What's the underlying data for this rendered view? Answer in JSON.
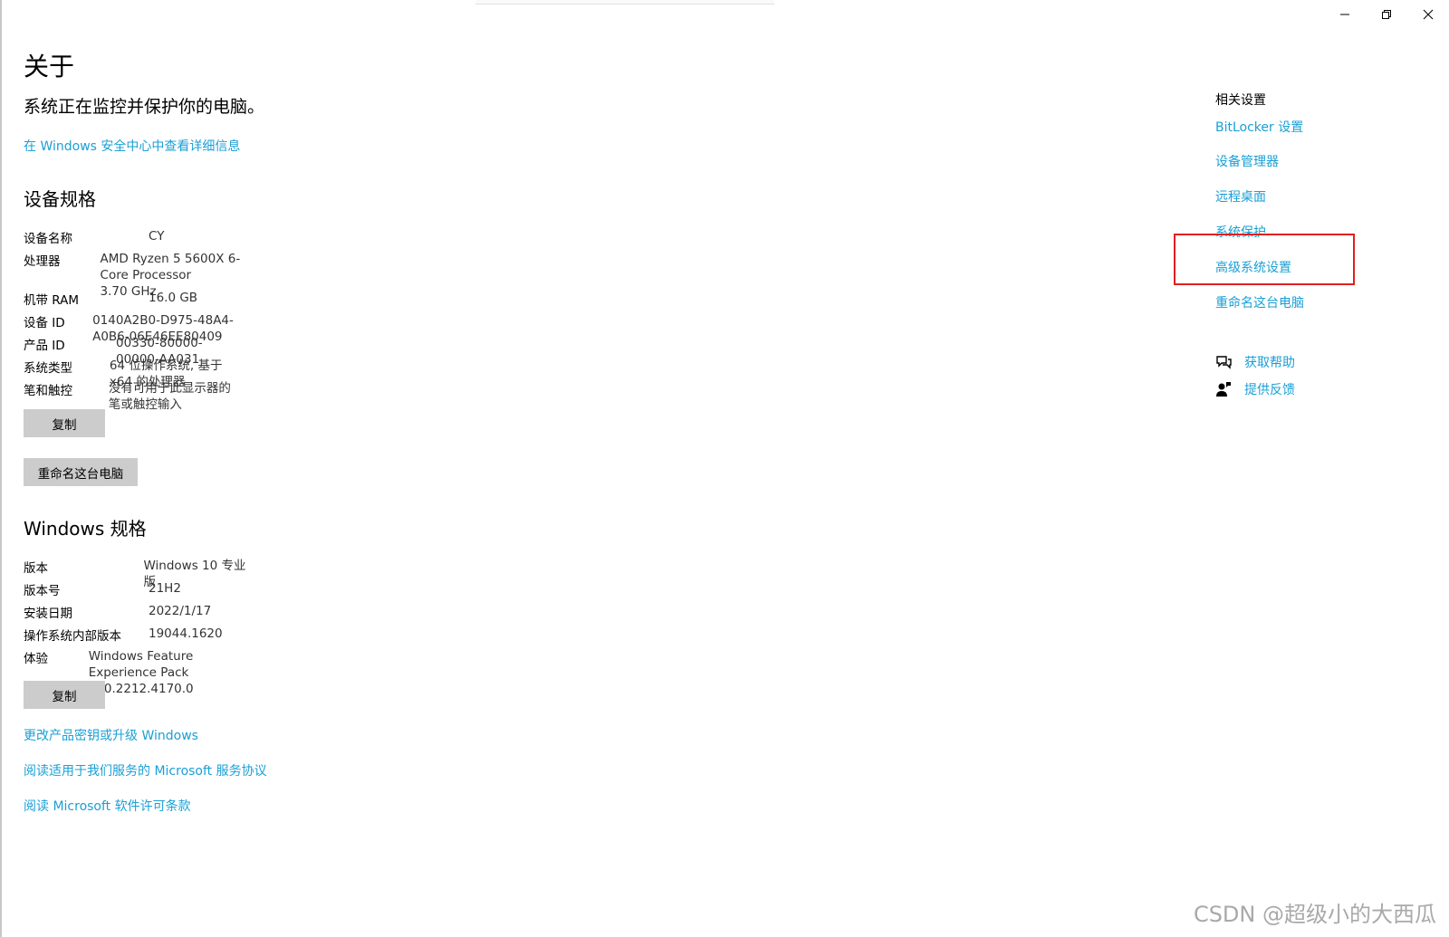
{
  "window": {
    "controls": {
      "minimize": "minimize-icon",
      "maximize": "restore-icon",
      "close": "close-icon"
    }
  },
  "main": {
    "title": "关于",
    "status": "系统正在监控并保护你的电脑。",
    "security_link": "在 Windows 安全中心中查看详细信息",
    "device_specs": {
      "heading": "设备规格",
      "rows": [
        {
          "key": "设备名称",
          "value": "CY"
        },
        {
          "key": "处理器",
          "value": "AMD Ryzen 5 5600X 6-Core Processor\n3.70 GHz"
        },
        {
          "key": "机带 RAM",
          "value": "16.0 GB"
        },
        {
          "key": "设备 ID",
          "value": "0140A2B0-D975-48A4-A0B6-06E46EE80409"
        },
        {
          "key": "产品 ID",
          "value": "00330-80000-00000-AA031"
        },
        {
          "key": "系统类型",
          "value": "64 位操作系统, 基于 x64 的处理器"
        },
        {
          "key": "笔和触控",
          "value": "没有可用于此显示器的笔或触控输入"
        }
      ],
      "copy_button": "复制",
      "rename_button": "重命名这台电脑"
    },
    "windows_specs": {
      "heading": "Windows 规格",
      "rows": [
        {
          "key": "版本",
          "value": "Windows 10 专业版"
        },
        {
          "key": "版本号",
          "value": "21H2"
        },
        {
          "key": "安装日期",
          "value": "2022/1/17"
        },
        {
          "key": "操作系统内部版本",
          "value": "19044.1620"
        },
        {
          "key": "体验",
          "value": "Windows Feature Experience Pack 120.2212.4170.0"
        }
      ],
      "copy_button": "复制"
    },
    "links": [
      "更改产品密钥或升级 Windows",
      "阅读适用于我们服务的 Microsoft 服务协议",
      "阅读 Microsoft 软件许可条款"
    ]
  },
  "related": {
    "title": "相关设置",
    "links": [
      "BitLocker 设置",
      "设备管理器",
      "远程桌面",
      "系统保护",
      "高级系统设置",
      "重命名这台电脑"
    ],
    "help": [
      {
        "label": "获取帮助",
        "icon": "get-help-icon"
      },
      {
        "label": "提供反馈",
        "icon": "feedback-icon"
      }
    ]
  },
  "annotation": {
    "highlight_color": "#e02020"
  },
  "colors": {
    "link": "#1a9fd6",
    "button_bg": "#cccccc"
  },
  "watermark": "CSDN @超级小的大西瓜"
}
